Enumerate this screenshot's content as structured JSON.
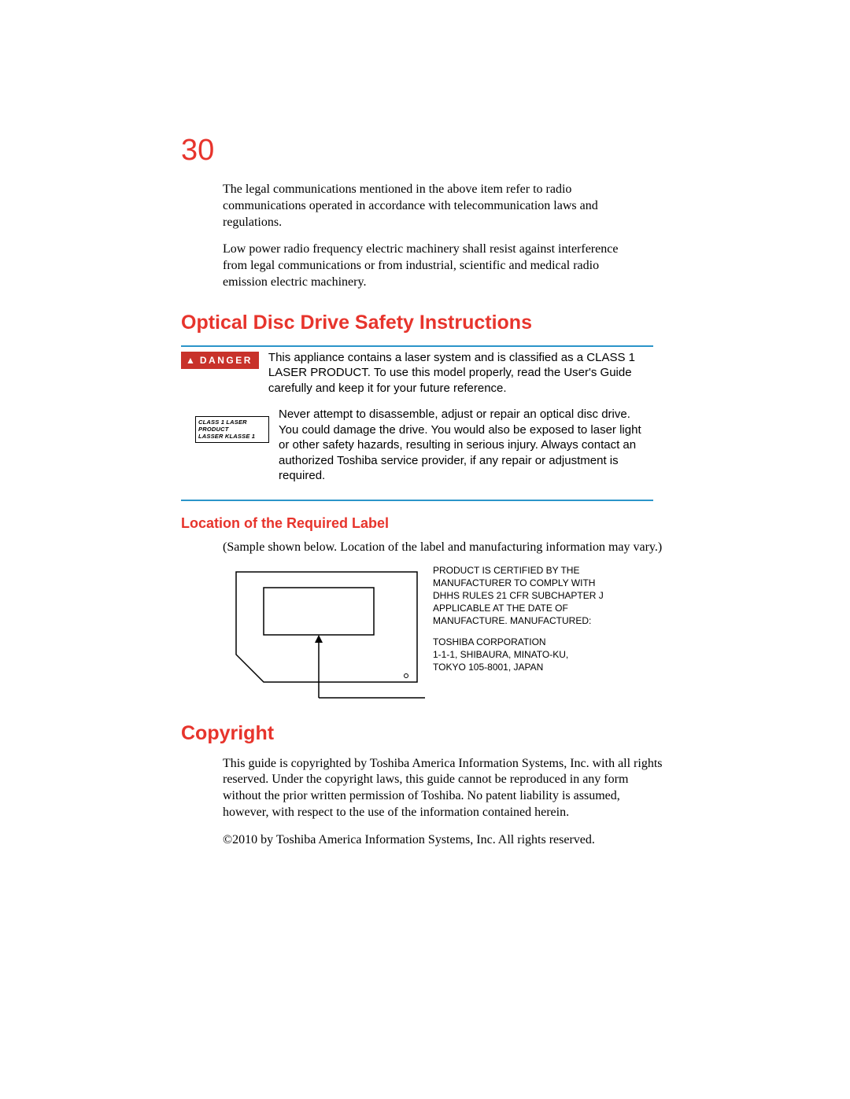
{
  "pageNumber": "30",
  "intro": {
    "p1": "The legal communications mentioned in the above item refer to radio communications operated in accordance with telecommunication laws and regulations.",
    "p2": "Low power radio frequency electric machinery shall resist against interference from legal communications or from industrial, scientific and medical radio emission electric machinery."
  },
  "section1": {
    "heading": "Optical Disc Drive Safety Instructions",
    "dangerLabel": "DANGER",
    "calloutP1": "This appliance contains a laser system and is classified as a CLASS 1 LASER PRODUCT. To use this model properly, read the User's Guide carefully and keep it for your future reference.",
    "calloutP2": "Never attempt to disassemble, adjust or repair an optical disc drive. You could damage the drive. You would also be exposed to laser light or other safety hazards, resulting in serious injury. Always contact an authorized Toshiba service provider, if any repair or adjustment is required.",
    "class1Line1": "CLASS 1 LASER PRODUCT",
    "class1Line2": "LASSER KLASSE 1"
  },
  "section2": {
    "heading": "Location of the Required Label",
    "intro": "(Sample shown below. Location of the label and manufacturing information may vary.)",
    "labelP1": "PRODUCT IS CERTIFIED BY THE MANUFACTURER TO COMPLY WITH DHHS RULES 21 CFR SUBCHAPTER J APPLICABLE AT THE DATE OF MANUFACTURE. MANUFACTURED:",
    "labelP2": "TOSHIBA CORPORATION\n1-1-1, SHIBAURA, MINATO-KU,\nTOKYO 105-8001, JAPAN"
  },
  "section3": {
    "heading": "Copyright",
    "p1": "This guide is copyrighted by Toshiba America Information Systems, Inc. with all rights reserved. Under the copyright laws, this guide cannot be reproduced in any form without the prior written permission of Toshiba. No patent liability is assumed, however, with respect to the use of the information contained herein.",
    "p2": "©2010 by Toshiba America Information Systems, Inc. All rights reserved."
  }
}
